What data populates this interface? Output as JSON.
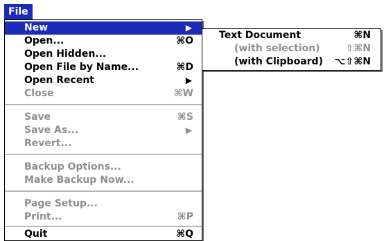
{
  "menubar": {
    "title": "File"
  },
  "menu": {
    "items": [
      {
        "label": "New",
        "shortcut": "",
        "submenu": true
      },
      {
        "label": "Open...",
        "shortcut": "⌘O"
      },
      {
        "label": "Open Hidden...",
        "shortcut": ""
      },
      {
        "label": "Open File by Name...",
        "shortcut": "⌘D"
      },
      {
        "label": "Open Recent",
        "shortcut": "",
        "submenu": true
      },
      {
        "label": "Close",
        "shortcut": "⌘W",
        "disabled": true
      },
      {
        "label": "Save",
        "shortcut": "⌘S",
        "disabled": true
      },
      {
        "label": "Save As...",
        "shortcut": "",
        "submenu": true,
        "disabled": true
      },
      {
        "label": "Revert...",
        "shortcut": "",
        "disabled": true
      },
      {
        "label": "Backup Options...",
        "shortcut": "",
        "disabled": true
      },
      {
        "label": "Make Backup Now...",
        "shortcut": "",
        "disabled": true
      },
      {
        "label": "Page Setup...",
        "shortcut": "",
        "disabled": true
      },
      {
        "label": "Print...",
        "shortcut": "⌘P",
        "disabled": true
      },
      {
        "label": "Quit",
        "shortcut": "⌘Q"
      }
    ]
  },
  "submenu_new": {
    "items": [
      {
        "label": "Text Document",
        "shortcut": "⌘N"
      },
      {
        "label": "(with selection)",
        "shortcut": "⇧⌘N",
        "disabled": true
      },
      {
        "label": "(with Clipboard)",
        "shortcut": "⌥⇧⌘N"
      }
    ]
  },
  "colors": {
    "highlight": "#1c2bb8",
    "disabled_text": "#8e8e8e"
  },
  "icons": {
    "submenu_arrow": "triangle-right-icon"
  }
}
